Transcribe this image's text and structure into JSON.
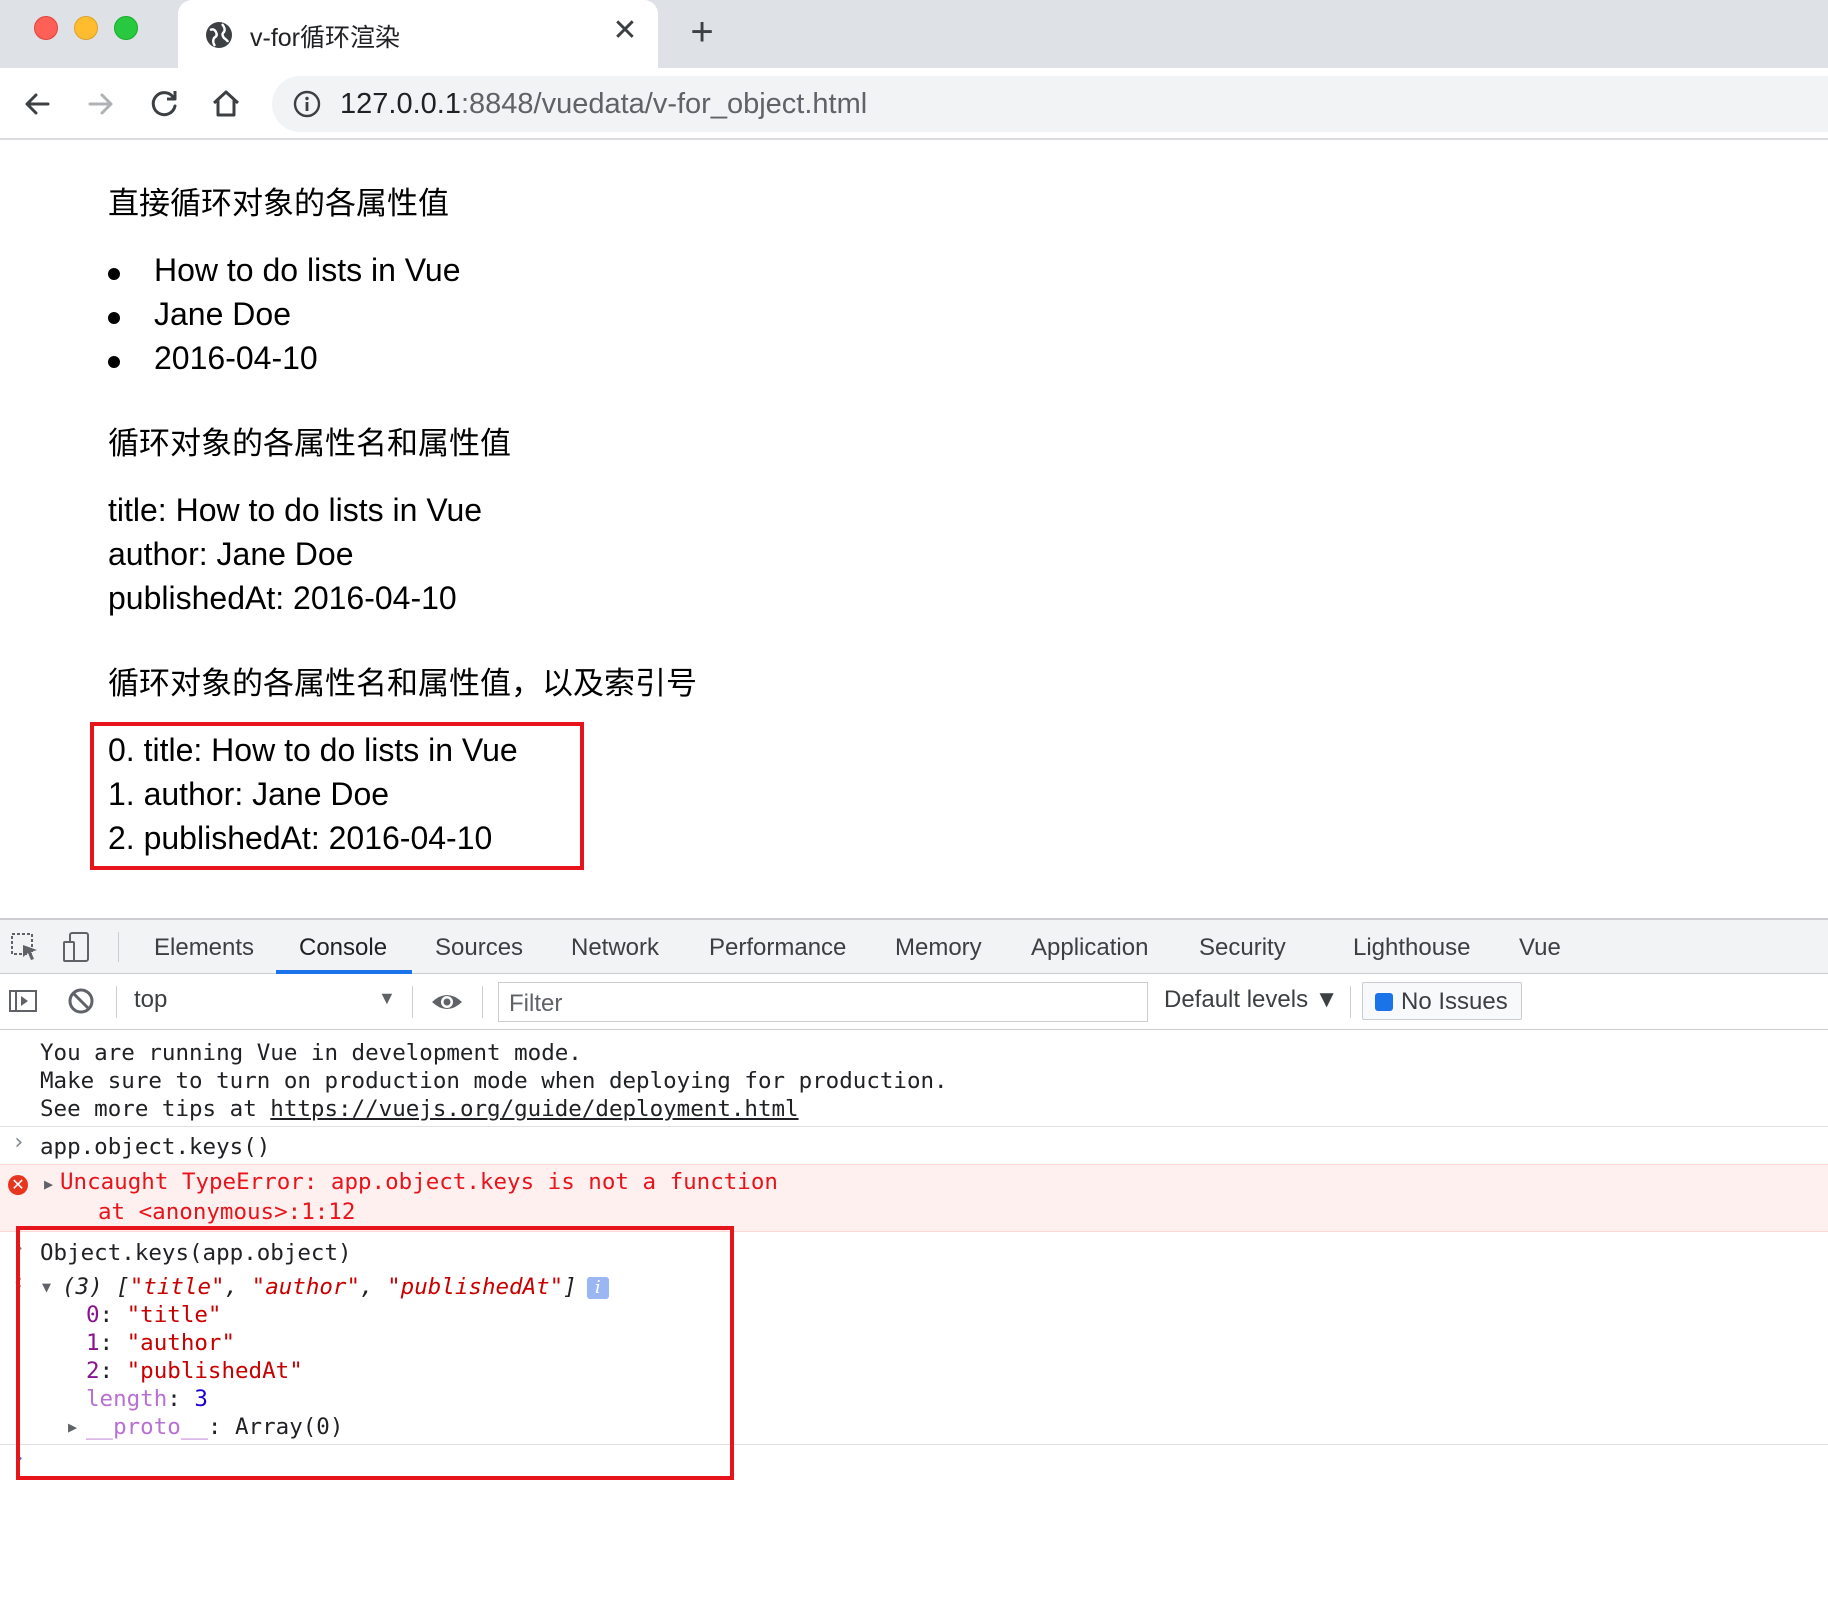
{
  "browser": {
    "tab_title": "v-for循环渲染",
    "tab_close": "✕",
    "new_tab": "+",
    "url_host": "127.0.0.1",
    "url_path": ":8848/vuedata/v-for_object.html"
  },
  "page": {
    "section1_heading": "直接循环对象的各属性值",
    "section1_items": [
      "How to do lists in Vue",
      "Jane Doe",
      "2016-04-10"
    ],
    "section2_heading": "循环对象的各属性名和属性值",
    "section2_lines": [
      "title: How to do lists in Vue",
      "author: Jane Doe",
      "publishedAt: 2016-04-10"
    ],
    "section3_heading": "循环对象的各属性名和属性值，以及索引号",
    "section3_lines": [
      "0. title: How to do lists in Vue",
      "1. author: Jane Doe",
      "2. publishedAt: 2016-04-10"
    ]
  },
  "devtools": {
    "tabs": [
      "Elements",
      "Console",
      "Sources",
      "Network",
      "Performance",
      "Memory",
      "Application",
      "Security",
      "Lighthouse",
      "Vue"
    ],
    "active_tab": "Console",
    "context": "top",
    "filter_placeholder": "Filter",
    "levels": "Default levels ▼",
    "issues": "No Issues",
    "console": {
      "vue_msg_1": "You are running Vue in development mode.",
      "vue_msg_2": "Make sure to turn on production mode when deploying for production.",
      "vue_msg_3_prefix": "See more tips at ",
      "vue_msg_3_link": "https://vuejs.org/guide/deployment.html",
      "input_1": "app.object.keys()",
      "error_text": "Uncaught TypeError: app.object.keys is not a function",
      "error_at": "at <anonymous>:1:12",
      "input_2": "Object.keys(app.object)",
      "result_summary_prefix": "(3) [",
      "result_summary_items": [
        "\"title\"",
        "\"author\"",
        "\"publishedAt\""
      ],
      "result_summary_suffix": "]",
      "entries": [
        {
          "key": "0",
          "value": "\"title\""
        },
        {
          "key": "1",
          "value": "\"author\""
        },
        {
          "key": "2",
          "value": "\"publishedAt\""
        }
      ],
      "length_key": "length",
      "length_value": "3",
      "proto_key": "__proto__",
      "proto_value": "Array(0)"
    }
  },
  "colors": {
    "highlight_box": "#e8141b",
    "devtools_active": "#1a73e8",
    "error_red": "#e8141b"
  }
}
